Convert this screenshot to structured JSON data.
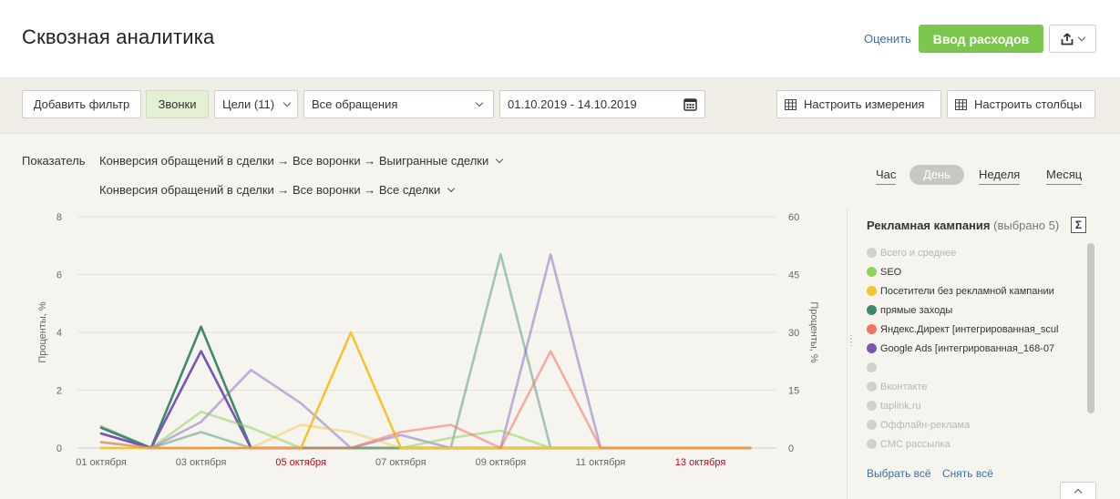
{
  "header": {
    "title": "Сквозная аналитика",
    "rate_link": "Оценить",
    "primary_button": "Ввод расходов",
    "export_icon": "upload-icon"
  },
  "toolbar": {
    "add_filter": "Добавить фильтр",
    "calls": "Звонки",
    "goals": "Цели (11)",
    "requests_select": "Все обращения",
    "date_range": "01.10.2019 - 14.10.2019",
    "configure_dimensions": "Настроить измерения",
    "configure_columns": "Настроить столбцы"
  },
  "metrics": {
    "label": "Показатель",
    "primary": "Конверсия обращений в сделки → Все воронки → Выигранные сделки",
    "secondary": "Конверсия обращений в сделки → Все воронки → Все сделки"
  },
  "periods": [
    "Час",
    "День",
    "Неделя",
    "Месяц"
  ],
  "selected_period": "День",
  "chart_data": {
    "type": "line",
    "ylabel_left": "Проценты, %",
    "ylabel_right": "Проценты, %",
    "y_left_ticks": [
      "8",
      "6",
      "4",
      "2",
      "0"
    ],
    "y_right_ticks": [
      "60",
      "45",
      "30",
      "15",
      "0"
    ],
    "ylim_left": [
      0,
      8
    ],
    "ylim_right": [
      0,
      60
    ],
    "grid": true,
    "x": [
      "01 октября",
      "02 октября",
      "03 октября",
      "04 октября",
      "05 октября",
      "06 октября",
      "07 октября",
      "08 октября",
      "09 октября",
      "10 октября",
      "11 октября",
      "12 октября",
      "13 октября",
      "14 октября"
    ],
    "x_tick_labels": [
      "01 октября",
      "03 октября",
      "05 октября",
      "07 октября",
      "09 октября",
      "11 октября",
      "13 октября"
    ],
    "weekend_tick_labels": [
      "05 октября",
      "13 октября"
    ],
    "weekend_color": "#d0021b",
    "series": [
      {
        "name": "прямые заходы",
        "color": "#3d8a6a",
        "opacity": 1.0,
        "values": [
          0.7,
          0,
          4.2,
          0,
          0,
          0,
          0,
          0,
          0,
          0,
          0,
          0,
          0,
          0
        ]
      },
      {
        "name": "Google Ads [интегрированная_168-07",
        "color": "#7b55b5",
        "opacity": 1.0,
        "values": [
          0.5,
          0,
          3.35,
          0,
          0,
          0,
          0,
          0,
          0,
          0,
          0,
          0,
          0,
          0
        ]
      },
      {
        "name": "прямые заходы",
        "color": "#3d8a6a",
        "opacity": 0.45,
        "values": [
          0.75,
          0,
          0.55,
          0,
          0,
          0,
          0,
          0,
          6.7,
          0,
          0,
          0,
          0,
          0
        ]
      },
      {
        "name": "Google Ads [интегрированная_168-07",
        "color": "#7b55b5",
        "opacity": 0.45,
        "values": [
          0.5,
          0,
          0.9,
          2.7,
          1.55,
          0,
          0.45,
          0,
          0,
          6.7,
          0,
          0,
          0,
          0
        ]
      },
      {
        "name": "SEO",
        "color": "#8ed45a",
        "opacity": 0.55,
        "values": [
          0.2,
          0,
          1.25,
          0.7,
          0,
          0,
          0,
          0.35,
          0.6,
          0,
          0,
          0,
          0,
          0
        ]
      },
      {
        "name": "Посетители без рекламной кампании",
        "color": "#f5c433",
        "opacity": 1.0,
        "values": [
          0,
          0,
          0,
          0,
          0,
          4.0,
          0,
          0,
          0,
          0,
          0,
          0,
          0,
          0
        ]
      },
      {
        "name": "Посетители без рекламной кампании",
        "color": "#f5c433",
        "opacity": 0.45,
        "values": [
          0,
          0,
          0,
          0,
          0.8,
          0.55,
          0,
          0,
          0,
          0,
          0,
          0,
          0,
          0
        ]
      },
      {
        "name": "Яндекс.Директ [интегрированная_scul",
        "color": "#f07560",
        "opacity": 0.55,
        "values": [
          0.2,
          0,
          0,
          0,
          0,
          0,
          0.55,
          0.8,
          0,
          3.35,
          0,
          0,
          0,
          0
        ]
      }
    ]
  },
  "legend": {
    "title": "Рекламная кампания",
    "selected_info": "(выбрано 5)",
    "sum_label": "Σ",
    "items": [
      {
        "label": "Всего и среднее",
        "color": "#d2d0ca",
        "active": false
      },
      {
        "label": "SEO",
        "color": "#8ed45a",
        "active": true
      },
      {
        "label": "Посетители без рекламной кампании",
        "color": "#f5c433",
        "active": true
      },
      {
        "label": "прямые заходы",
        "color": "#3d8a6a",
        "active": true
      },
      {
        "label": "Яндекс.Директ [интегрированная_scul",
        "color": "#f07560",
        "active": true
      },
      {
        "label": "Google Ads [интегрированная_168-07",
        "color": "#7b55b5",
        "active": true
      },
      {
        "label": "",
        "color": "#d2d0ca",
        "active": false
      },
      {
        "label": "Вконтакте",
        "color": "#d2d0ca",
        "active": false
      },
      {
        "label": "taplink.ru",
        "color": "#d2d0ca",
        "active": false
      },
      {
        "label": "Оффлайн-реклама",
        "color": "#d2d0ca",
        "active": false
      },
      {
        "label": "СМС рассылка",
        "color": "#d2d0ca",
        "active": false
      }
    ],
    "select_all": "Выбрать всё",
    "deselect_all": "Снять всё"
  }
}
